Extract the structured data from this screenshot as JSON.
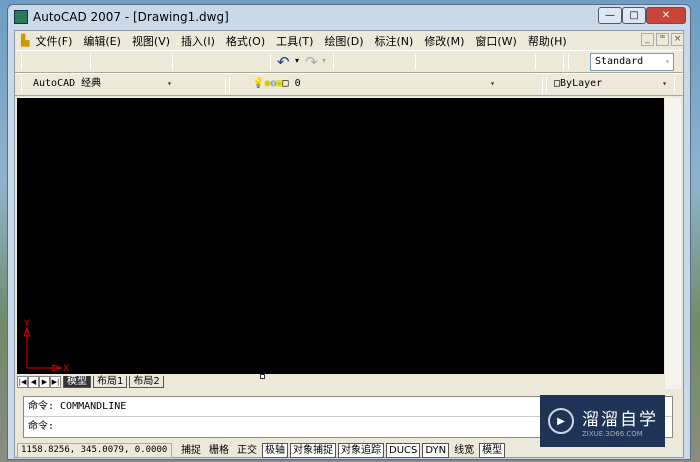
{
  "title": "AutoCAD 2007 - [Drawing1.dwg]",
  "menu": [
    "文件(F)",
    "编辑(E)",
    "视图(V)",
    "插入(I)",
    "格式(O)",
    "工具(T)",
    "绘图(D)",
    "标注(N)",
    "修改(M)",
    "窗口(W)",
    "帮助(H)"
  ],
  "toolbar": {
    "text_style": "Standard",
    "workspace": "AutoCAD 经典",
    "layer": "0",
    "color": "ByLayer"
  },
  "axes": {
    "x": "X",
    "y": "Y"
  },
  "tabs": [
    "模型",
    "布局1",
    "布局2"
  ],
  "command": {
    "line1": "命令: COMMANDLINE",
    "line2": "命令:"
  },
  "status": {
    "coords": "1158.8256, 345.0079, 0.0000",
    "buttons": [
      "捕捉",
      "栅格",
      "正交",
      "极轴",
      "对象捕捉",
      "对象追踪",
      "DUCS",
      "DYN",
      "线宽",
      "模型"
    ]
  },
  "watermark": {
    "name": "溜溜自学",
    "url": "ZIXUE.3D66.COM"
  }
}
